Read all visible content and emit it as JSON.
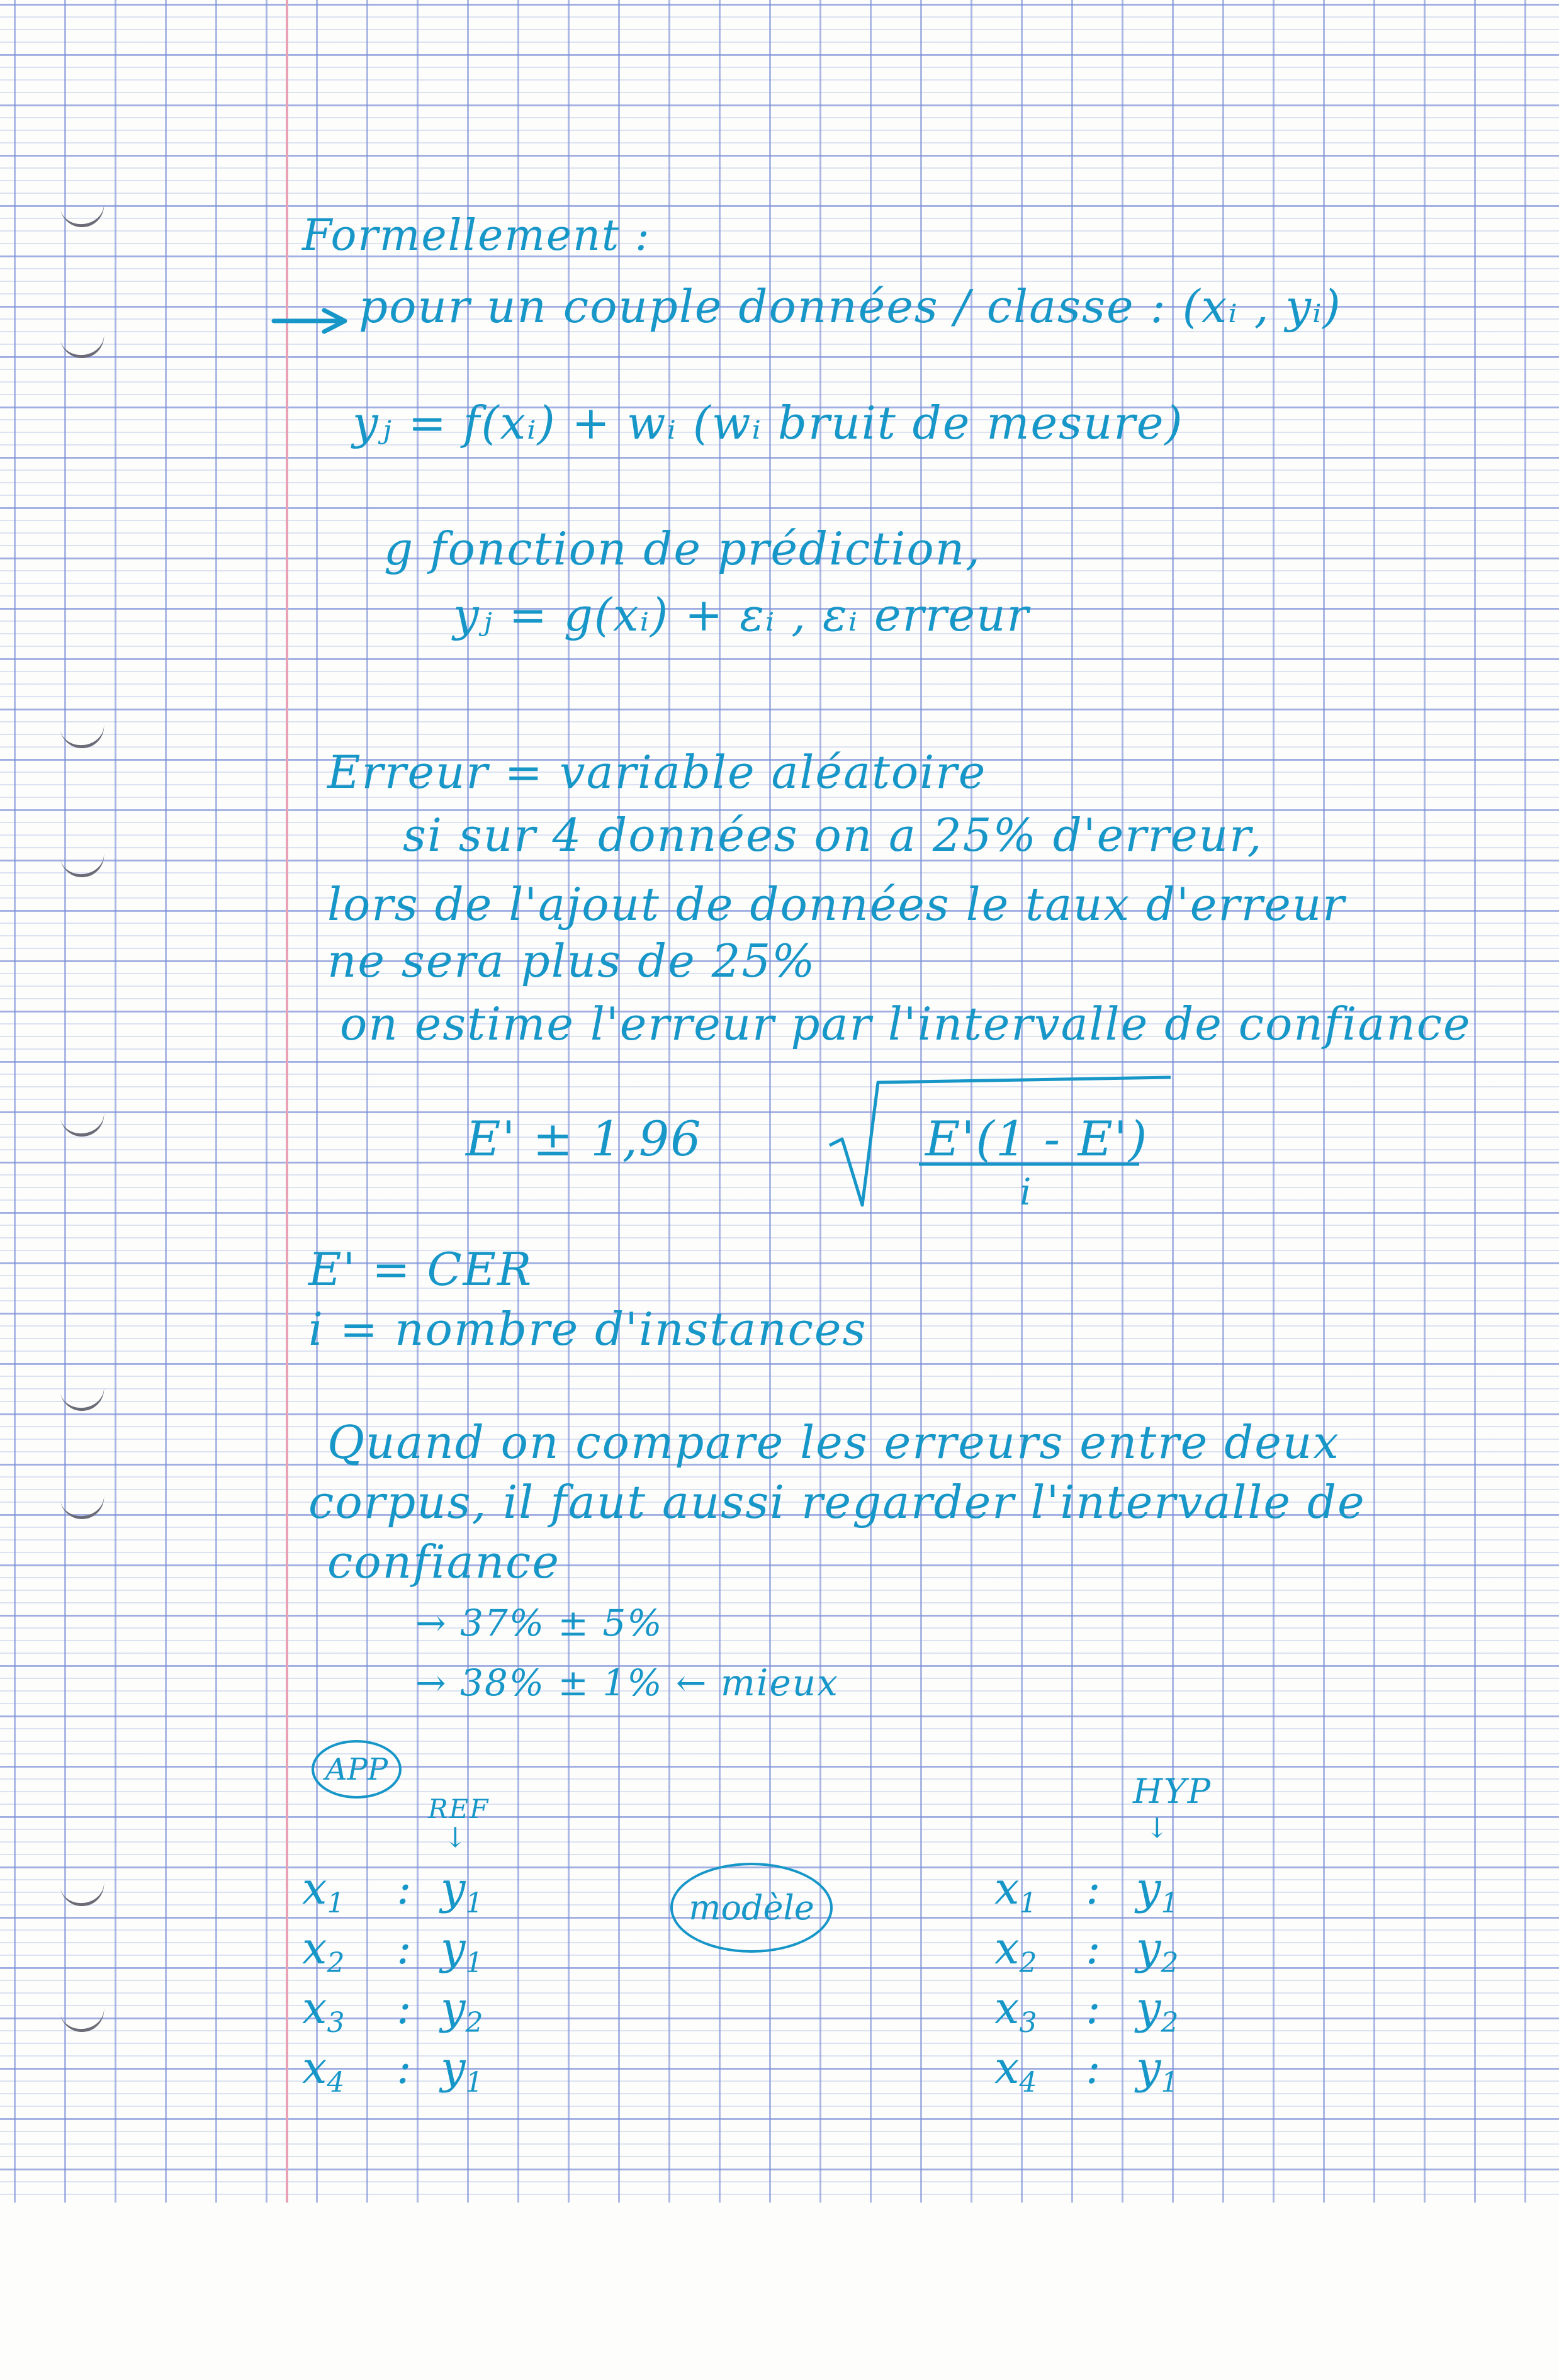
{
  "notes": {
    "title": "Formellement :",
    "intro": "pour un couple données / classe : (xᵢ , yᵢ)",
    "eq1": "yⱼ = f(xᵢ) + wᵢ   (wᵢ bruit de mesure)",
    "pred_label": "g fonction de prédiction,",
    "eq2": "yⱼ = g(xᵢ) + εᵢ   ,   εᵢ erreur",
    "error_title": "Erreur = variable aléatoire",
    "p1": "si sur 4 données on a 25% d'erreur,",
    "p2": "lors de l'ajout de données le taux d'erreur",
    "p3": "ne sera plus de 25%",
    "p4": "on estime l'erreur par l'intervalle de confiance",
    "formula_prefix": "E' ± 1,96",
    "formula_radicand": "E'(1 - E')",
    "formula_denominator": "i",
    "def1": "E' = CER",
    "def2": "i = nombre d'instances",
    "q1": "Quand on compare les erreurs entre deux",
    "q2": "corpus, il faut aussi regarder l'intervalle de",
    "q3": "confiance",
    "ex1": "→  37% ± 5%",
    "ex2": "→  38% ± 1%  ←  mieux"
  },
  "diagram": {
    "app_label": "APP",
    "ref_label": "REF",
    "hyp_label": "HYP",
    "down_arrow": "↓",
    "model_label": "modèle",
    "colon": ":",
    "x_var": "x",
    "y_var": "y",
    "left_rows": [
      {
        "xsub": "1",
        "ysub": "1"
      },
      {
        "xsub": "2",
        "ysub": "1"
      },
      {
        "xsub": "3",
        "ysub": "2"
      },
      {
        "xsub": "4",
        "ysub": "1"
      }
    ],
    "right_rows": [
      {
        "xsub": "1",
        "ysub": "1"
      },
      {
        "xsub": "2",
        "ysub": "2"
      },
      {
        "xsub": "3",
        "ysub": "2"
      },
      {
        "xsub": "4",
        "ysub": "1"
      }
    ]
  },
  "colors": {
    "ink": "#1796c8",
    "grid": "#7f92d8",
    "margin": "#e7a3b5",
    "paper": "#fdfdfb"
  }
}
